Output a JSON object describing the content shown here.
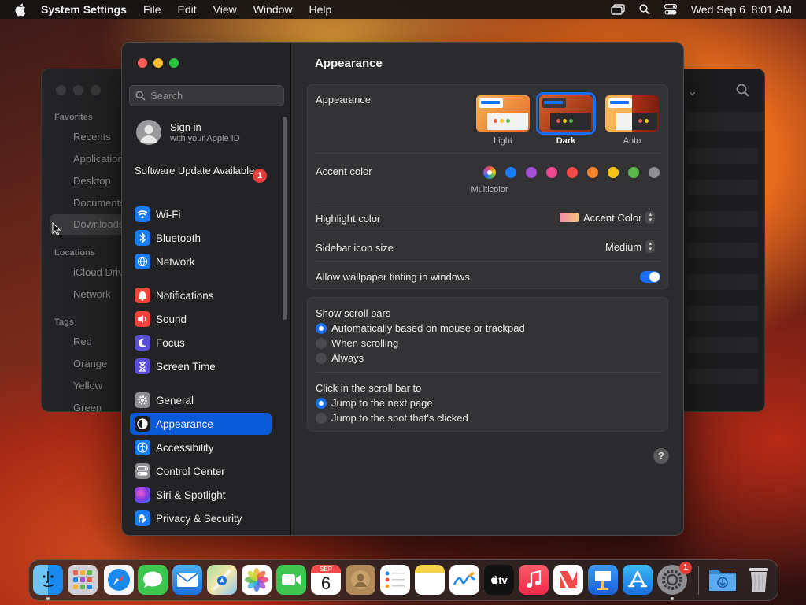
{
  "menubar": {
    "app_name": "System Settings",
    "menus": [
      "File",
      "Edit",
      "View",
      "Window",
      "Help"
    ],
    "clock": "Wed Sep 6  8:01 AM"
  },
  "finder": {
    "favorites_header": "Favorites",
    "favorites": [
      "Recents",
      "Applications",
      "Desktop",
      "Documents",
      "Downloads"
    ],
    "locations_header": "Locations",
    "locations": [
      "iCloud Drive",
      "Network"
    ],
    "tags_header": "Tags",
    "tags": [
      "Red",
      "Orange",
      "Yellow",
      "Green"
    ]
  },
  "sidebar": {
    "search_placeholder": "Search",
    "signin_title": "Sign in",
    "signin_subtitle": "with your Apple ID",
    "update_label": "Software Update Available",
    "update_badge": "1",
    "items": [
      {
        "label": "Wi-Fi",
        "color": "#1a7cf5"
      },
      {
        "label": "Bluetooth",
        "color": "#1a7cf5"
      },
      {
        "label": "Network",
        "color": "#1a7cf5"
      },
      {
        "label": "Notifications",
        "color": "#f0443a"
      },
      {
        "label": "Sound",
        "color": "#f0443a"
      },
      {
        "label": "Focus",
        "color": "#5a4fd6"
      },
      {
        "label": "Screen Time",
        "color": "#5a4fd6"
      },
      {
        "label": "General",
        "color": "#8e8e93"
      },
      {
        "label": "Appearance",
        "color": "#1c1c1e"
      },
      {
        "label": "Accessibility",
        "color": "#1a7cf5"
      },
      {
        "label": "Control Center",
        "color": "#8e8e93"
      },
      {
        "label": "Siri & Spotlight",
        "color": "#c04ad8"
      },
      {
        "label": "Privacy & Security",
        "color": "#1a7cf5"
      }
    ],
    "selected": "Appearance"
  },
  "content": {
    "title": "Appearance",
    "appearance_label": "Appearance",
    "appearance_options": [
      "Light",
      "Dark",
      "Auto"
    ],
    "appearance_selected": "Dark",
    "accent_label": "Accent color",
    "accent_caption": "Multicolor",
    "accent_colors": [
      "#1a7cf5",
      "#a550d6",
      "#f0468e",
      "#f04a4a",
      "#f5842a",
      "#f5c418",
      "#5ab848",
      "#8e8e93"
    ],
    "highlight_label": "Highlight color",
    "highlight_value": "Accent Color",
    "icon_size_label": "Sidebar icon size",
    "icon_size_value": "Medium",
    "tinting_label": "Allow wallpaper tinting in windows",
    "tinting_on": true,
    "scrollbars_label": "Show scroll bars",
    "scrollbars_options": [
      "Automatically based on mouse or trackpad",
      "When scrolling",
      "Always"
    ],
    "click_label": "Click in the scroll bar to",
    "click_options": [
      "Jump to the next page",
      "Jump to the spot that's clicked"
    ],
    "help": "?"
  },
  "dock": {
    "calendar_month": "SEP",
    "calendar_day": "6",
    "tv_label": "tv",
    "settings_badge": "1",
    "apps": [
      "finder-icon",
      "launchpad-icon",
      "safari-icon",
      "messages-icon",
      "mail-icon",
      "maps-icon",
      "photos-icon",
      "facetime-icon",
      "calendar-icon",
      "contacts-icon",
      "reminders-icon",
      "notes-icon",
      "freeform-icon",
      "apple-tv-icon",
      "music-icon",
      "news-icon",
      "keynote-icon",
      "app-store-icon",
      "system-settings-icon",
      "downloads-folder-icon",
      "trash-icon"
    ]
  }
}
